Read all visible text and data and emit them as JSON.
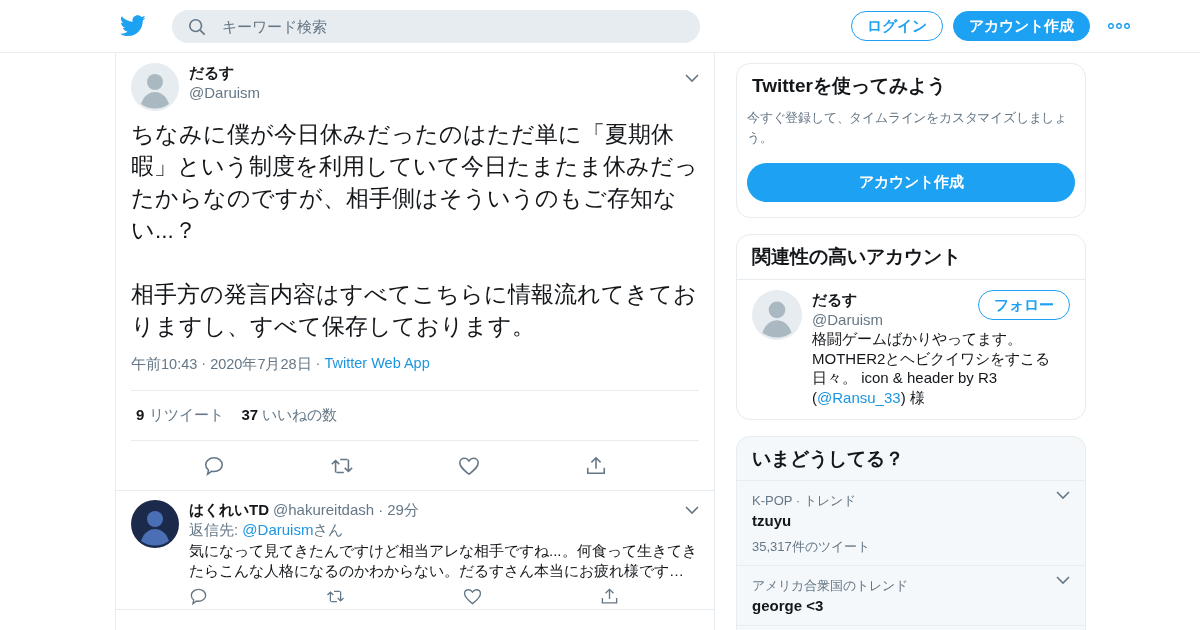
{
  "header": {
    "search_placeholder": "キーワード検索",
    "login_button": "ログイン",
    "signup_button": "アカウント作成"
  },
  "tweet": {
    "name": "だるす",
    "handle": "@Daruism",
    "paragraphs": [
      "ちなみに僕が今日休みだったのはただ単に「夏期休暇」という制度を利用していて今日たまたま休みだったからなのですが、相手側はそういうのもご存知ない...？",
      "相手方の発言内容はすべてこちらに情報流れてきておりますし、すべて保存しております。"
    ],
    "time": "午前10:43",
    "date": "2020年7月28日",
    "source": "Twitter Web App",
    "separator": "·",
    "stats": [
      {
        "count": "9",
        "label": "リツイート"
      },
      {
        "count": "37",
        "label": "いいねの数"
      }
    ]
  },
  "reply": {
    "name": "はくれいTD",
    "handle": "@hakureitdash",
    "separator": "·",
    "age": "29分",
    "reply_to_label": "返信先:",
    "reply_to_handle": "@Daruism",
    "reply_to_suffix": "さん",
    "text": "気になって見てきたんですけど相当アレな相手ですね...。何食って生きてきたらこんな人格になるのかわからない。だるすさん本当にお疲れ様です…"
  },
  "signup_card": {
    "title": "Twitterを使ってみよう",
    "description": "今すぐ登録して、タイムラインをカスタマイズしましょう。",
    "button": "アカウント作成"
  },
  "related_card": {
    "title": "関連性の高いアカウント",
    "name": "だるす",
    "handle": "@Daruism",
    "follow_button": "フォロー",
    "bio_before": "格闘ゲームばかりやってます。MOTHER2とヘビクイワシをすこる日々。 icon & header by R3 (",
    "bio_link": "@Ransu_33",
    "bio_after": ") 様"
  },
  "trends_card": {
    "title": "いまどうしてる？",
    "trends": [
      {
        "context": "K-POP · トレンド",
        "name": "tzuyu",
        "count": "35,317件のツイート"
      },
      {
        "context": "アメリカ合衆国のトレンド",
        "name": "george <3"
      }
    ]
  }
}
